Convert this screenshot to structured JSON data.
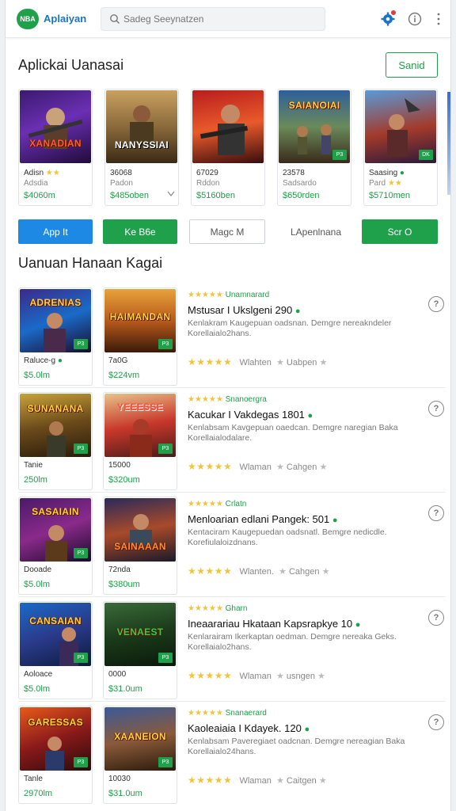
{
  "header": {
    "logo_badge": "NBA",
    "app_name": "Aplaiyan",
    "search_placeholder": "Sadeg Seeynatzen"
  },
  "featured": {
    "title": "Aplickai Uanasai",
    "see_all": "Sanid",
    "items": [
      {
        "art": "XANADIAN",
        "name": "Adisn",
        "sub": "Adsdia",
        "price": "$4060m",
        "stars": "★★"
      },
      {
        "art": "NANYSSIAI",
        "name": "36068",
        "sub": "Padon",
        "price": "$485oben",
        "stars": ""
      },
      {
        "art": "",
        "name": "67029",
        "sub": "Rddon",
        "price": "$5160ben",
        "stars": ""
      },
      {
        "art": "SAIANOIAI",
        "name": "23578",
        "sub": "Sadsardo",
        "price": "$650rden",
        "stars": ""
      },
      {
        "art": "",
        "name": "Saasing",
        "sub": "Pard",
        "price": "$5710men",
        "stars": "★★"
      }
    ]
  },
  "chips": [
    "App It",
    "Ke B6e",
    "Magc M",
    "LApenlnana",
    "Scr O"
  ],
  "list": {
    "title": "Uanuan Hanaan Kagai",
    "rows": [
      {
        "art1": "ADRENIAS",
        "art2": "HAIMANDAN",
        "card1_name": "Raluce-g",
        "card1_price": "$5.0lm",
        "card2_name": "7a0G",
        "card2_price": "$224vm",
        "meta": "Unamnarard",
        "title": "Mstusar I Ukslgeni 290",
        "desc": "Kenlakram Kaugepuan oadsnan. Demgre nereakndeler Korellaialo2hans.",
        "left_word": "Wlahten",
        "right_word": "Uabpen"
      },
      {
        "art1": "SUNANANA",
        "art2": "YEEESSE",
        "card1_name": "Tanie",
        "card1_price": "250lm",
        "card2_name": "15000",
        "card2_price": "$320um",
        "meta": "Snanoergra",
        "title": "Kacukar I Vakdegas 1801",
        "desc": "Kenlabsam Kavgepuan oaedcan. Demgre naregian Baka Korellaialodalare.",
        "left_word": "Wlaman",
        "right_word": "Cahgen"
      },
      {
        "art1": "SASAIAIN",
        "art2": "SAINAAAN",
        "card1_name": "Dooade",
        "card1_price": "$5.0lm",
        "card2_name": "72nda",
        "card2_price": "$380um",
        "meta": "Crlatn",
        "title": "Menloarian edlani Pangek: 501",
        "desc": "Kentaciram Kaugepuedan oadsnatl. Bemgre nedicdle. Korefiulaloizdnans.",
        "left_word": "Wlanten.",
        "right_word": "Cahgen"
      },
      {
        "art1": "CANSAIAN",
        "art2": "VENAEST",
        "card1_name": "Aoloace",
        "card1_price": "$5.0lm",
        "card2_name": "0000",
        "card2_price": "$31.0um",
        "meta": "Gharn",
        "title": "Ineaarariau Hkataan Kapsrapkye 10",
        "desc": "Kenlarairam Ikerkaptan oedman. Demgre nereaka Geks. Korellaialo2hans.",
        "left_word": "Wlaman",
        "right_word": "usngen"
      },
      {
        "art1": "GARESSAS",
        "art2": "XAANEION",
        "card1_name": "Tanle",
        "card1_price": "2970lm",
        "card2_name": "10030",
        "card2_price": "$31.0um",
        "meta": "Snanaerard",
        "title": "Kaoleaiaia I Kdayek. 120",
        "desc": "Kenlabsam Paveregiaet oadcnan. Demgre nereagian Baka Korellaialo24hans.",
        "left_word": "Wlaman",
        "right_word": "Caitgen"
      }
    ]
  },
  "colors": {
    "accent_green": "#1fa04a",
    "accent_blue": "#1a73c8",
    "star": "#f2c43a"
  }
}
